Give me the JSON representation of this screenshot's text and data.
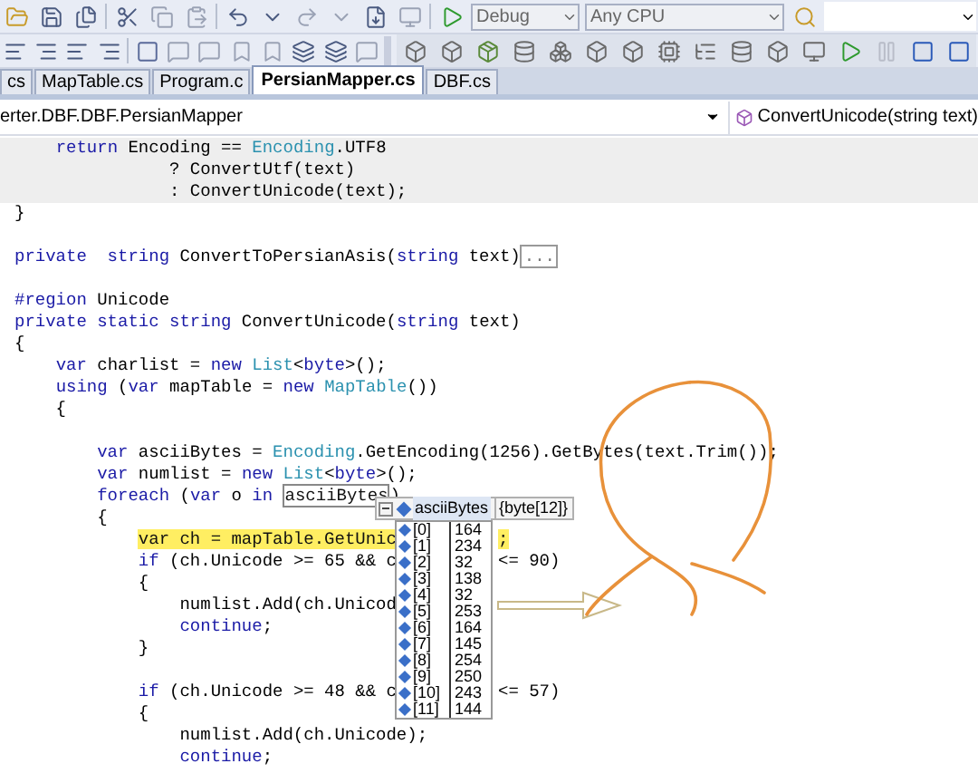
{
  "toolbar": {
    "configuration": "Debug",
    "platform": "Any CPU"
  },
  "tabs": [
    {
      "label": "cs",
      "selected": false
    },
    {
      "label": "MapTable.cs",
      "selected": false
    },
    {
      "label": "Program.c",
      "selected": false
    },
    {
      "label": "PersianMapper.cs",
      "selected": true
    },
    {
      "label": "DBF.cs",
      "selected": false
    }
  ],
  "navigation": {
    "type_selector": "erter.DBF.DBF.PersianMapper",
    "member_selector": "ConvertUnicode(string text)"
  },
  "code_lines": [
    {
      "kind": "code",
      "shaded": true,
      "segments": [
        {
          "text": "    return",
          "kind": "keyword"
        },
        {
          "text": " Encoding == ",
          "kind": "plain"
        },
        {
          "text": "Encoding",
          "kind": "type"
        },
        {
          "text": ".UTF8",
          "kind": "plain"
        }
      ]
    },
    {
      "kind": "code",
      "shaded": true,
      "segments": [
        {
          "text": "               ? ConvertUtf(text)",
          "kind": "plain"
        }
      ]
    },
    {
      "kind": "code",
      "shaded": true,
      "segments": [
        {
          "text": "               : ConvertUnicode(text);",
          "kind": "plain"
        }
      ]
    },
    {
      "kind": "code",
      "shaded": false,
      "segments": [
        {
          "text": "}",
          "kind": "plain"
        }
      ]
    },
    {
      "kind": "blank"
    },
    {
      "kind": "code",
      "shaded": false,
      "segments": [
        {
          "text": "private  string",
          "kind": "keyword"
        },
        {
          "text": " ConvertToPersianAsis(",
          "kind": "plain"
        },
        {
          "text": "string",
          "kind": "keyword"
        },
        {
          "text": " text)",
          "kind": "plain"
        },
        {
          "text": "...",
          "kind": "collapsed"
        }
      ]
    },
    {
      "kind": "blank"
    },
    {
      "kind": "code",
      "shaded": false,
      "segments": [
        {
          "text": "#region",
          "kind": "keyword"
        },
        {
          "text": " Unicode",
          "kind": "plain"
        }
      ]
    },
    {
      "kind": "code",
      "shaded": false,
      "segments": [
        {
          "text": "private static string",
          "kind": "keyword"
        },
        {
          "text": " ConvertUnicode(",
          "kind": "plain"
        },
        {
          "text": "string",
          "kind": "keyword"
        },
        {
          "text": " text)",
          "kind": "plain"
        }
      ]
    },
    {
      "kind": "code",
      "shaded": false,
      "segments": [
        {
          "text": "{",
          "kind": "plain"
        }
      ]
    },
    {
      "kind": "code",
      "shaded": false,
      "segments": [
        {
          "text": "    var",
          "kind": "keyword"
        },
        {
          "text": " charlist = ",
          "kind": "plain"
        },
        {
          "text": "new",
          "kind": "keyword"
        },
        {
          "text": " List",
          "kind": "type"
        },
        {
          "text": "<",
          "kind": "plain"
        },
        {
          "text": "byte",
          "kind": "keyword"
        },
        {
          "text": ">();",
          "kind": "plain"
        }
      ]
    },
    {
      "kind": "code",
      "shaded": false,
      "segments": [
        {
          "text": "    using",
          "kind": "keyword"
        },
        {
          "text": " (",
          "kind": "plain"
        },
        {
          "text": "var",
          "kind": "keyword"
        },
        {
          "text": " mapTable = ",
          "kind": "plain"
        },
        {
          "text": "new",
          "kind": "keyword"
        },
        {
          "text": " MapTable",
          "kind": "type"
        },
        {
          "text": "())",
          "kind": "plain"
        }
      ]
    },
    {
      "kind": "code",
      "shaded": false,
      "segments": [
        {
          "text": "    {",
          "kind": "plain"
        }
      ]
    },
    {
      "kind": "blank"
    },
    {
      "kind": "code",
      "shaded": false,
      "segments": [
        {
          "text": "        var",
          "kind": "keyword"
        },
        {
          "text": " asciiBytes = ",
          "kind": "plain"
        },
        {
          "text": "Encoding",
          "kind": "type"
        },
        {
          "text": ".GetEncoding(1256).GetBytes(text.Trim());",
          "kind": "plain"
        }
      ]
    },
    {
      "kind": "code",
      "shaded": false,
      "segments": [
        {
          "text": "        var",
          "kind": "keyword"
        },
        {
          "text": " numlist = ",
          "kind": "plain"
        },
        {
          "text": "new",
          "kind": "keyword"
        },
        {
          "text": " List",
          "kind": "type"
        },
        {
          "text": "<",
          "kind": "plain"
        },
        {
          "text": "byte",
          "kind": "keyword"
        },
        {
          "text": ">();",
          "kind": "plain"
        }
      ]
    },
    {
      "kind": "code",
      "shaded": false,
      "segments": [
        {
          "text": "        foreach",
          "kind": "keyword"
        },
        {
          "text": " (",
          "kind": "plain"
        },
        {
          "text": "var",
          "kind": "keyword"
        },
        {
          "text": " o ",
          "kind": "plain"
        },
        {
          "text": "in ",
          "kind": "keyword"
        },
        {
          "text": "asciiBytes",
          "kind": "hovered"
        },
        {
          "text": ")",
          "kind": "plain"
        }
      ]
    },
    {
      "kind": "code",
      "shaded": false,
      "segments": [
        {
          "text": "        {",
          "kind": "plain"
        }
      ]
    },
    {
      "kind": "code",
      "shaded": false,
      "segments": [
        {
          "text": "            var ch = mapTable.GetUnic",
          "kind": "current"
        }
      ],
      "tail": [
        {
          "text": ";",
          "kind": "current"
        }
      ]
    },
    {
      "kind": "code",
      "shaded": false,
      "segments": [
        {
          "text": "            if",
          "kind": "keyword"
        },
        {
          "text": " (ch.Unicode >= 65 && c",
          "kind": "plain"
        }
      ],
      "tail": [
        {
          "text": "<= 90)",
          "kind": "plain"
        }
      ]
    },
    {
      "kind": "code",
      "shaded": false,
      "segments": [
        {
          "text": "            {",
          "kind": "plain"
        }
      ]
    },
    {
      "kind": "code",
      "shaded": false,
      "segments": [
        {
          "text": "                numlist.Add(ch.Unicod",
          "kind": "plain"
        }
      ]
    },
    {
      "kind": "code",
      "shaded": false,
      "segments": [
        {
          "text": "                continue",
          "kind": "keyword"
        },
        {
          "text": ";",
          "kind": "plain"
        }
      ]
    },
    {
      "kind": "code",
      "shaded": false,
      "segments": [
        {
          "text": "            }",
          "kind": "plain"
        }
      ]
    },
    {
      "kind": "blank"
    },
    {
      "kind": "code",
      "shaded": false,
      "segments": [
        {
          "text": "            if",
          "kind": "keyword"
        },
        {
          "text": " (ch.Unicode >= 48 && c",
          "kind": "plain"
        }
      ],
      "tail": [
        {
          "text": "<= 57)",
          "kind": "plain"
        }
      ]
    },
    {
      "kind": "code",
      "shaded": false,
      "segments": [
        {
          "text": "            {",
          "kind": "plain"
        }
      ]
    },
    {
      "kind": "code",
      "shaded": false,
      "segments": [
        {
          "text": "                numlist.Add(ch.Unicode);",
          "kind": "plain"
        }
      ]
    },
    {
      "kind": "code",
      "shaded": false,
      "segments": [
        {
          "text": "                continue",
          "kind": "keyword"
        },
        {
          "text": ";",
          "kind": "plain"
        }
      ]
    }
  ],
  "data_tip": {
    "name": "asciiBytes",
    "value": "{byte[12]}",
    "items": [
      {
        "index": "[0]",
        "value": "164"
      },
      {
        "index": "[1]",
        "value": "234"
      },
      {
        "index": "[2]",
        "value": "32"
      },
      {
        "index": "[3]",
        "value": "138"
      },
      {
        "index": "[4]",
        "value": "32"
      },
      {
        "index": "[5]",
        "value": "253"
      },
      {
        "index": "[6]",
        "value": "164"
      },
      {
        "index": "[7]",
        "value": "145"
      },
      {
        "index": "[8]",
        "value": "254"
      },
      {
        "index": "[9]",
        "value": "250"
      },
      {
        "index": "[10]",
        "value": "243"
      },
      {
        "index": "[11]",
        "value": "144"
      }
    ]
  }
}
